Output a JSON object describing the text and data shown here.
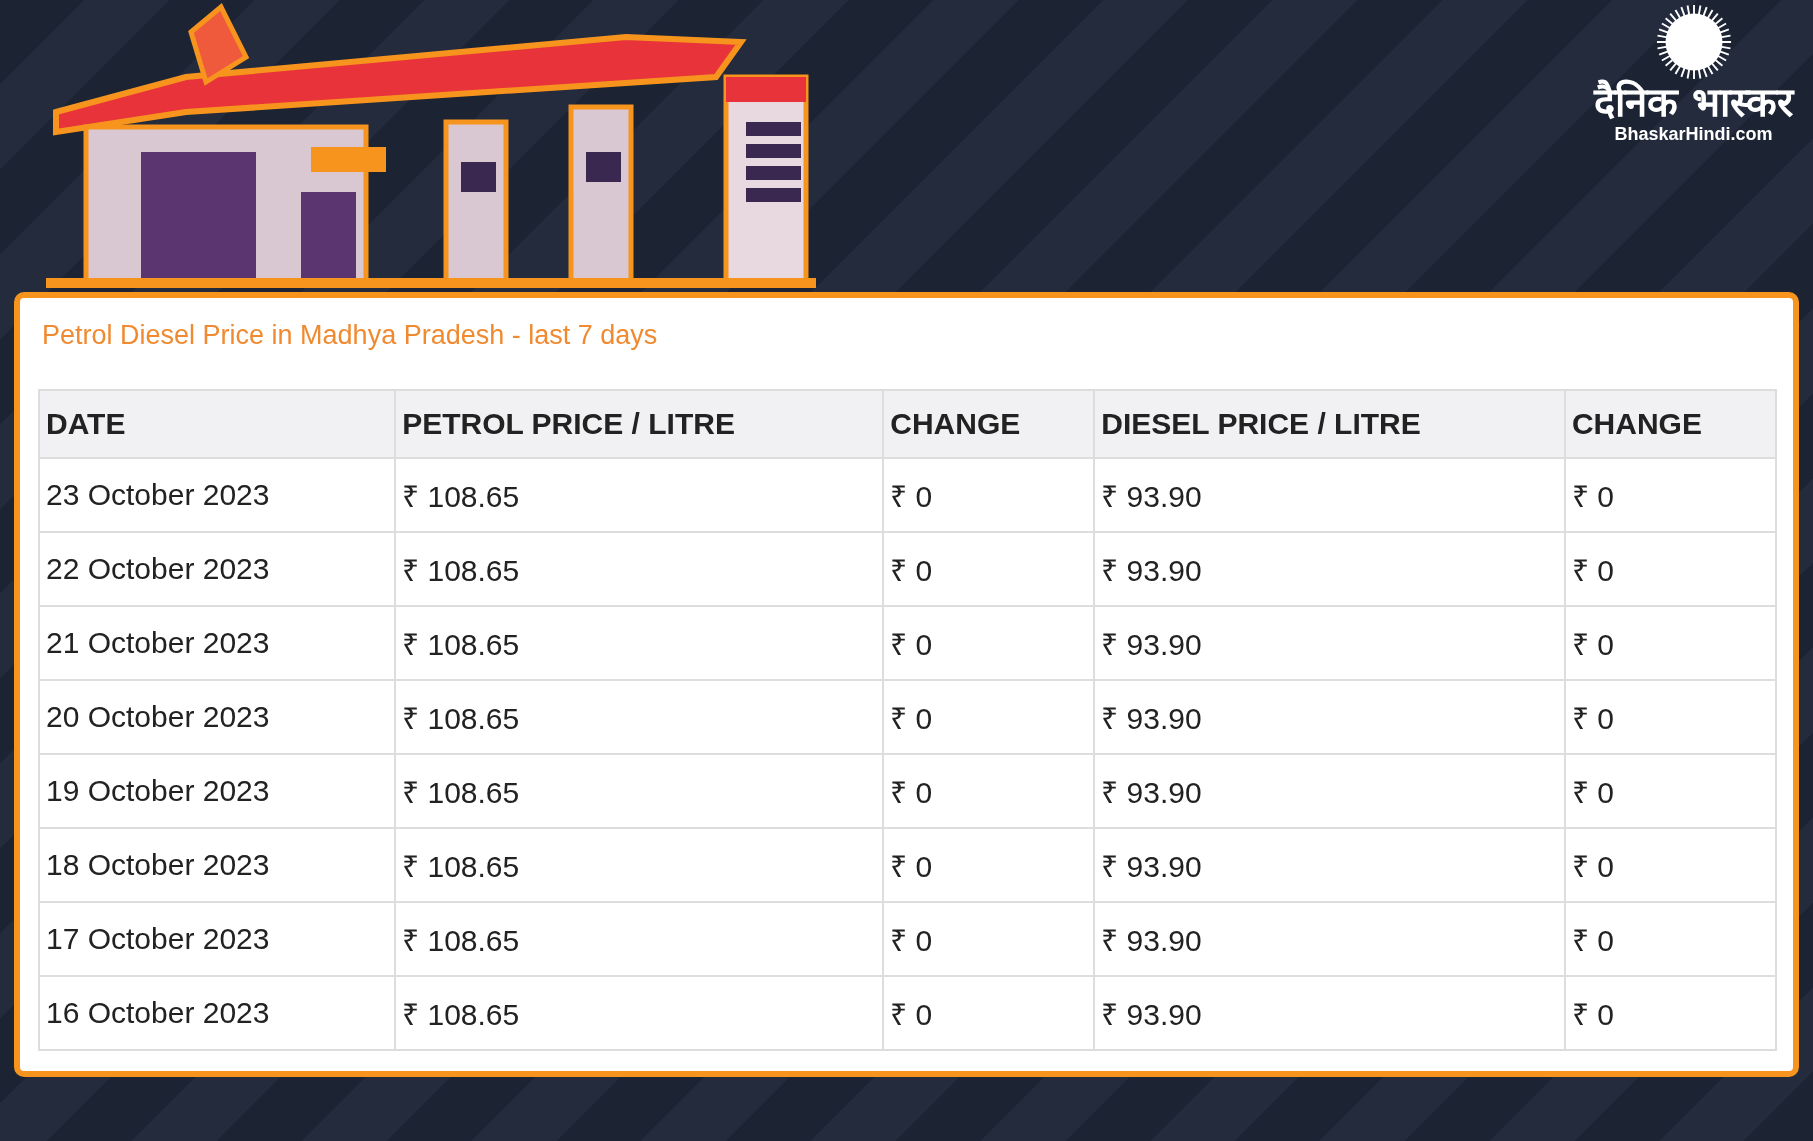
{
  "logo": {
    "title": "दैनिक भास्कर",
    "site": "BhaskarHindi.com"
  },
  "table": {
    "title": "Petrol Diesel Price in Madhya Pradesh - last 7 days",
    "columns": [
      "DATE",
      "PETROL PRICE / LITRE",
      "CHANGE",
      "DIESEL PRICE / LITRE",
      "CHANGE"
    ],
    "rows": [
      [
        "23 October 2023",
        "₹ 108.65",
        "₹ 0",
        "₹ 93.90",
        "₹ 0"
      ],
      [
        "22 October 2023",
        "₹ 108.65",
        "₹ 0",
        "₹ 93.90",
        "₹ 0"
      ],
      [
        "21 October 2023",
        "₹ 108.65",
        "₹ 0",
        "₹ 93.90",
        "₹ 0"
      ],
      [
        "20 October 2023",
        "₹ 108.65",
        "₹ 0",
        "₹ 93.90",
        "₹ 0"
      ],
      [
        "19 October 2023",
        "₹ 108.65",
        "₹ 0",
        "₹ 93.90",
        "₹ 0"
      ],
      [
        "18 October 2023",
        "₹ 108.65",
        "₹ 0",
        "₹ 93.90",
        "₹ 0"
      ],
      [
        "17 October 2023",
        "₹ 108.65",
        "₹ 0",
        "₹ 93.90",
        "₹ 0"
      ],
      [
        "16 October 2023",
        "₹ 108.65",
        "₹ 0",
        "₹ 93.90",
        "₹ 0"
      ]
    ]
  }
}
